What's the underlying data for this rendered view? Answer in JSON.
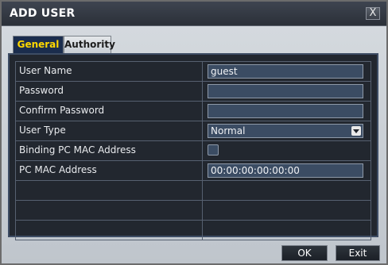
{
  "window": {
    "title": "ADD USER",
    "close_label": "X"
  },
  "tabs": [
    {
      "label": "General",
      "active": true
    },
    {
      "label": "Authority",
      "active": false
    }
  ],
  "form": {
    "rows": [
      {
        "label": "User Name",
        "type": "text",
        "value": "guest"
      },
      {
        "label": "Password",
        "type": "password",
        "value": ""
      },
      {
        "label": "Confirm Password",
        "type": "password",
        "value": ""
      },
      {
        "label": "User Type",
        "type": "select",
        "value": "Normal"
      },
      {
        "label": "Binding PC MAC Address",
        "type": "checkbox",
        "checked": false
      },
      {
        "label": "PC MAC Address",
        "type": "text",
        "value": "00:00:00:00:00:00"
      }
    ]
  },
  "buttons": {
    "ok": "OK",
    "exit": "Exit"
  },
  "colors": {
    "active_tab_text": "#ffd800",
    "panel_background": "#22272f",
    "field_background": "#3b4c63"
  }
}
